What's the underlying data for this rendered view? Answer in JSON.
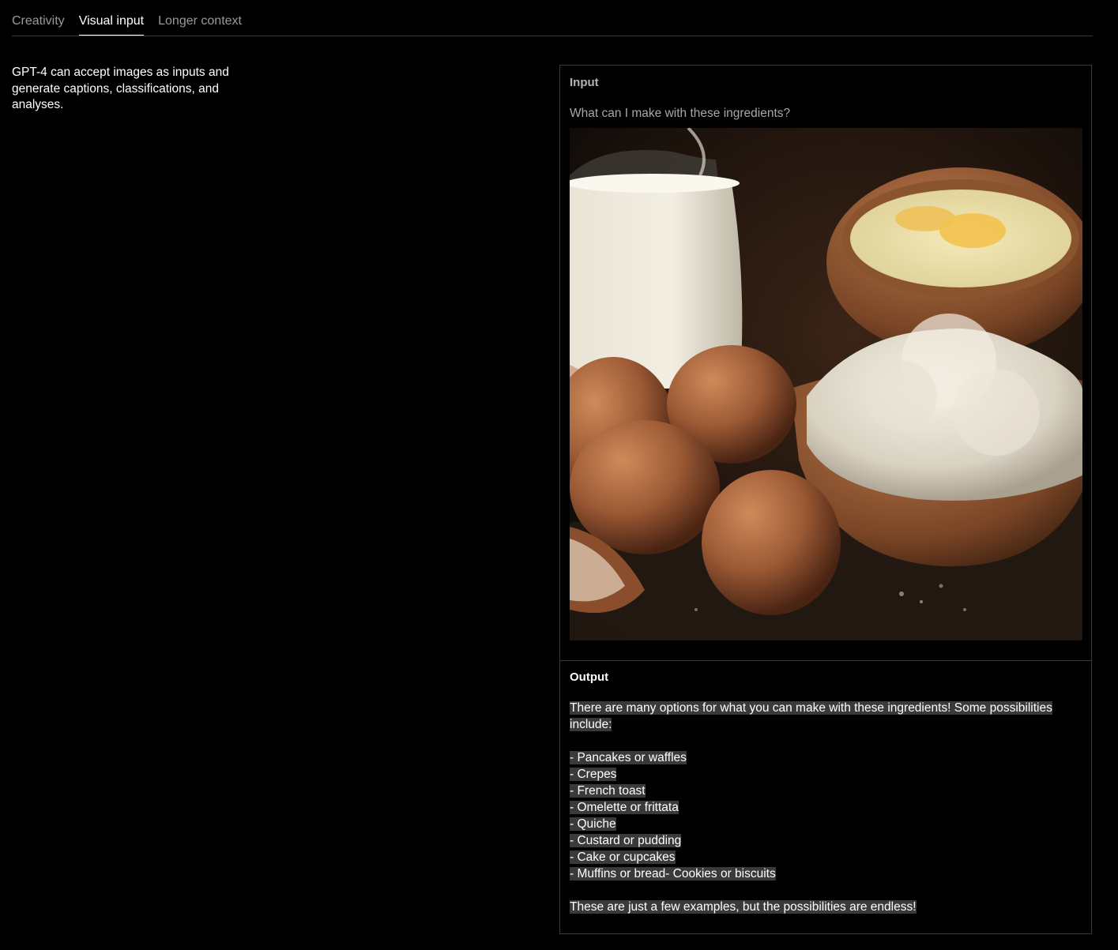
{
  "tabs": [
    {
      "label": "Creativity",
      "active": false
    },
    {
      "label": "Visual input",
      "active": true
    },
    {
      "label": "Longer context",
      "active": false
    }
  ],
  "description": "GPT-4 can accept images as inputs and generate captions, classifications, and analyses.",
  "panel": {
    "input_label": "Input",
    "prompt": "What can I make with these ingredients?",
    "output_label": "Output",
    "output_intro": "There are many options for what you can make with these ingredients! Some possibilities include:",
    "output_items": [
      "- Pancakes or waffles",
      "- Crepes",
      "- French toast",
      "- Omelette or frittata",
      "- Quiche",
      "- Custard or pudding",
      "- Cake or cupcakes",
      "- Muffins or bread- Cookies or biscuits"
    ],
    "output_outro": "These are just a few examples, but the possibilities are endless!"
  },
  "colors": {
    "background": "#000000",
    "divider": "#3a3a3a",
    "highlight": "#3a3a3a",
    "muted_text": "#9a9a9a"
  }
}
